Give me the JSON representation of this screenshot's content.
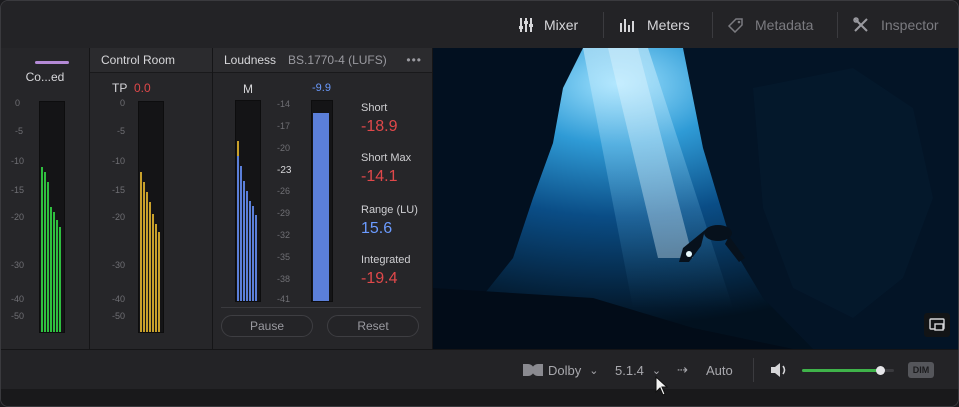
{
  "toolbar": {
    "mixer_label": "Mixer",
    "meters_label": "Meters",
    "metadata_label": "Metadata",
    "inspector_label": "Inspector"
  },
  "channel_panel": {
    "title": "Co...ed",
    "scale": [
      "0",
      "-5",
      "-10",
      "-15",
      "-20",
      "-30",
      "-40",
      "-50"
    ]
  },
  "control_room": {
    "title": "Control Room",
    "tp_label": "TP",
    "tp_value": "0.0",
    "scale": [
      "0",
      "-5",
      "-10",
      "-15",
      "-20",
      "-30",
      "-40",
      "-50"
    ]
  },
  "loudness": {
    "title": "Loudness",
    "standard": "BS.1770-4 (LUFS)",
    "more": "•••",
    "m_label": "M",
    "m_value": "-9.9",
    "scale": [
      "-14",
      "-17",
      "-20",
      "-23",
      "-26",
      "-29",
      "-32",
      "-35",
      "-38",
      "-41"
    ],
    "short_label": "Short",
    "short_value": "-18.9",
    "short_max_label": "Short Max",
    "short_max_value": "-14.1",
    "range_label": "Range (LU)",
    "range_value": "15.6",
    "integrated_label": "Integrated",
    "integrated_value": "-19.4",
    "pause_label": "Pause",
    "reset_label": "Reset"
  },
  "bottombar": {
    "dolby_label": "Dolby",
    "format_label": "5.1.4",
    "arrow": "⇢",
    "auto_label": "Auto",
    "dim_label": "DIM",
    "volume_level": 0.85
  },
  "colors": {
    "meter_green": "#2fbf3f",
    "meter_amber": "#c8a02b",
    "meter_blue": "#5b7fd9",
    "value_red": "#e0484a",
    "value_blue": "#6b9bff",
    "volume_green": "#3fb34a",
    "channel_accent": "#b48ad6"
  }
}
